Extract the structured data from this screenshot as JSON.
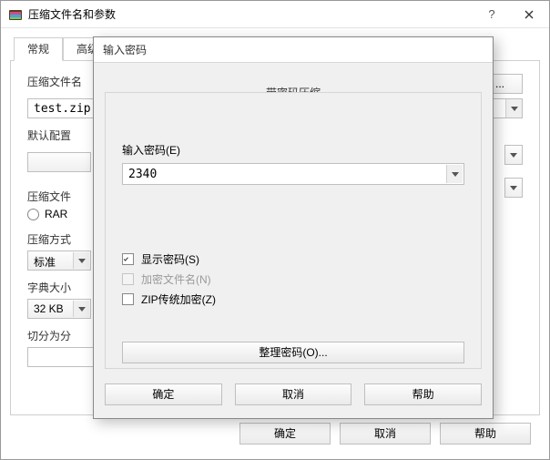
{
  "main": {
    "title": "压缩文件名和参数",
    "tabs": [
      "常规",
      "高级"
    ],
    "filename_label": "压缩文件名",
    "filename_value": "test.zip",
    "browse": "...",
    "default_profile_label": "默认配置",
    "format_label": "压缩文件",
    "format_option": "RAR",
    "method_label": "压缩方式",
    "method_value": "标准",
    "dict_label": "字典大小",
    "dict_value": "32 KB",
    "split_label": "切分为分",
    "buttons": {
      "ok": "确定",
      "cancel": "取消",
      "help": "帮助"
    }
  },
  "modal": {
    "window_title": "输入密码",
    "group_title": "带密码压缩",
    "password_label": "输入密码(E)",
    "password_value": "2340",
    "show_password": "显示密码(S)",
    "encrypt_names": "加密文件名(N)",
    "zip_legacy": "ZIP传统加密(Z)",
    "organize": "整理密码(O)...",
    "buttons": {
      "ok": "确定",
      "cancel": "取消",
      "help": "帮助"
    }
  }
}
